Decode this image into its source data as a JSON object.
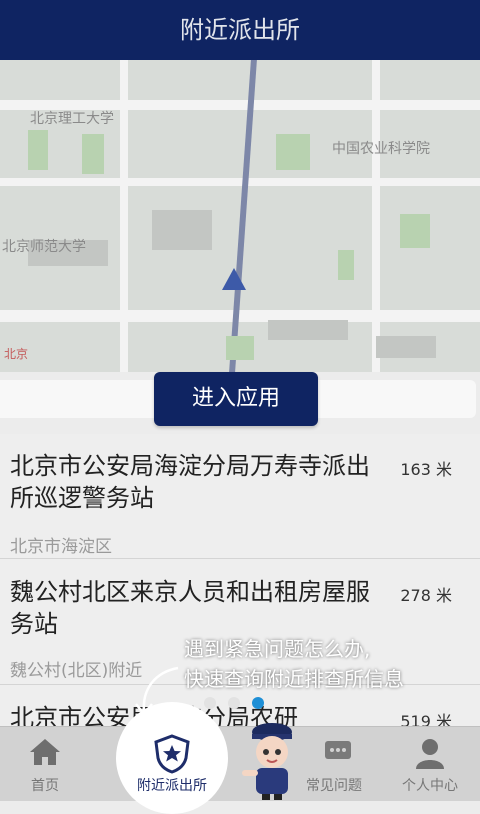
{
  "header": {
    "title": "附近派出所"
  },
  "map": {
    "labels": [
      "北京理工大学",
      "中国农业科学院",
      "北京师范大学"
    ],
    "corner_label": "北京"
  },
  "enter_button": {
    "label": "进入应用"
  },
  "list": {
    "items": [
      {
        "name": "北京市公安局海淀分局万寿寺派出所巡逻警务站",
        "address": "北京市海淀区",
        "distance": "163 米"
      },
      {
        "name": "魏公村北区来京人员和出租房屋服务站",
        "address": "魏公村(北区)附近",
        "distance": "278 米"
      },
      {
        "name": "北京市公安局海淀分局农研",
        "address": "",
        "distance": "519 米"
      }
    ]
  },
  "overlay": {
    "line1": "遇到紧急问题怎么办,",
    "line2": "快速查询附近排查所信息"
  },
  "tabbar": {
    "tabs": [
      {
        "label": "首页",
        "icon": "home-icon"
      },
      {
        "label": "附近派出所",
        "icon": "police-badge-icon"
      },
      {
        "label": "常见问题",
        "icon": "chat-icon"
      },
      {
        "label": "个人中心",
        "icon": "user-icon"
      }
    ]
  },
  "colors": {
    "brand": "#0f2462",
    "indicator_active": "#1e8fd6",
    "indicator_inactive": "#e2e2e2"
  }
}
